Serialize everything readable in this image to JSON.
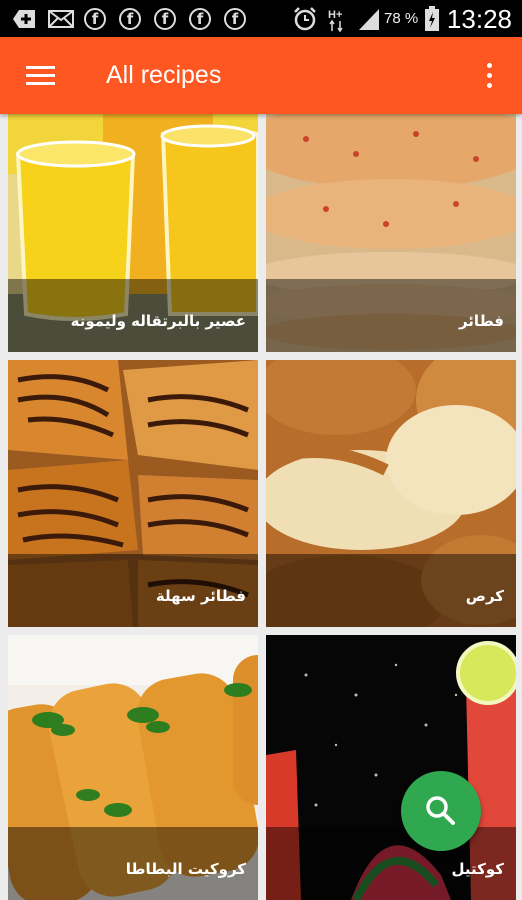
{
  "status_bar": {
    "battery_percent": "78 %",
    "time": "13:28",
    "notification_icons": [
      "add-box-icon",
      "mail-icon",
      "facebook-icon",
      "facebook-icon",
      "facebook-icon",
      "facebook-icon",
      "facebook-icon"
    ],
    "system_icons": [
      "alarm-icon",
      "data-h-plus-icon",
      "signal-icon",
      "battery-icon"
    ]
  },
  "app_bar": {
    "title": "All recipes",
    "left_icon": "menu-icon",
    "right_icon": "more-vert-icon",
    "background": "#ff5722"
  },
  "recipes": [
    {
      "name": "عصير بالبرتقاله وليمونه"
    },
    {
      "name": "فطائر"
    },
    {
      "name": "فطائر سهلة"
    },
    {
      "name": "كرص"
    },
    {
      "name": "كروكيت البطاطا"
    },
    {
      "name": "كوكتيل"
    }
  ],
  "fab": {
    "icon": "search-icon",
    "color": "#2fa84f"
  }
}
